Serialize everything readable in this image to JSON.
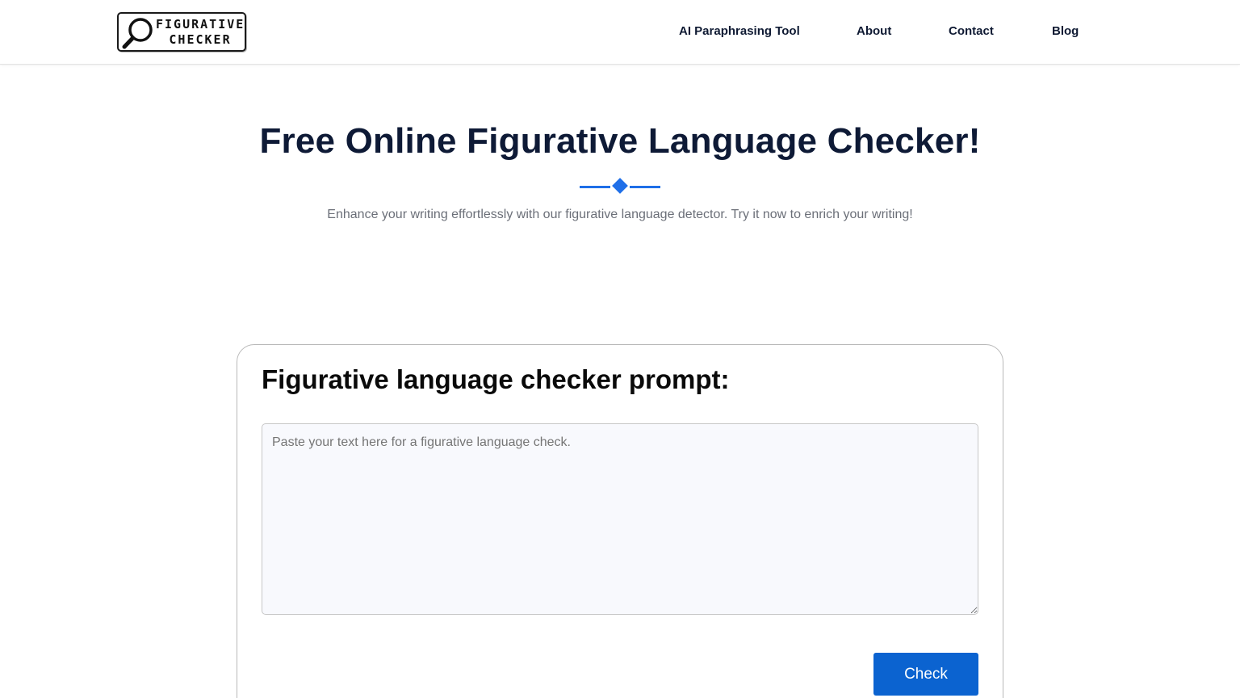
{
  "header": {
    "logo": {
      "line1": "FIGURATIVE",
      "line2": "CHECKER"
    },
    "nav": [
      {
        "label": "AI Paraphrasing Tool"
      },
      {
        "label": "About"
      },
      {
        "label": "Contact"
      },
      {
        "label": "Blog"
      }
    ]
  },
  "hero": {
    "title": "Free Online Figurative Language Checker!",
    "subtitle": "Enhance your writing effortlessly with our figurative language detector. Try it now to enrich your writing!"
  },
  "checker": {
    "title": "Figurative language checker prompt:",
    "input": {
      "value": "",
      "placeholder": "Paste your text here for a figurative language check."
    },
    "check_label": "Check"
  },
  "colors": {
    "accent": "#1f6fe8",
    "button": "#0b63d0",
    "heading": "#0e1a36"
  },
  "icons": {
    "logo": "magnifier-icon",
    "divider": "diamond-icon"
  }
}
